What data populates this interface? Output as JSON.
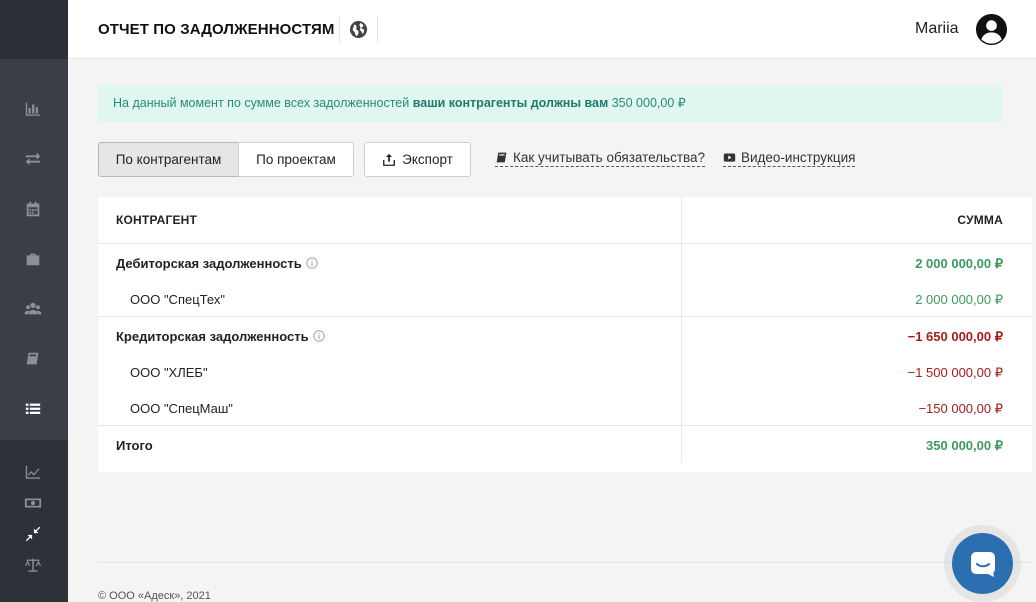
{
  "header": {
    "title": "ОТЧЕТ ПО ЗАДОЛЖЕННОСТЯМ",
    "username": "Mariia"
  },
  "sidebar": {
    "icons": [
      "bar-chart-icon",
      "transfer-icon",
      "calendar-icon",
      "briefcase-icon",
      "users-icon",
      "book-icon",
      "list-icon",
      "line-chart-icon",
      "money-icon",
      "compress-icon",
      "scales-icon"
    ],
    "active": "list-icon"
  },
  "notice": {
    "prefix": "На данный момент по сумме всех задолженностей",
    "emphasis": "ваши контрагенты должны вам",
    "amount": "350 000,00 ₽"
  },
  "toolbar": {
    "by_counterparty": "По контрагентам",
    "by_project": "По проектам",
    "export": "Экспорт",
    "how_to": "Как учитывать обязательства?",
    "video": "Видео-инструкция"
  },
  "table": {
    "col_counterparty": "КОНТРАГЕНТ",
    "col_amount": "СУММА",
    "receivables": {
      "label": "Дебиторская задолженность",
      "amount": "2 000 000,00 ₽",
      "items": [
        {
          "name": "ООО \"СпецТех\"",
          "amount": "2 000 000,00 ₽"
        }
      ]
    },
    "payables": {
      "label": "Кредиторская задолженность",
      "amount": "−1 650 000,00 ₽",
      "items": [
        {
          "name": "ООО \"ХЛЕБ\"",
          "amount": "−1 500 000,00 ₽"
        },
        {
          "name": "ООО \"СпецМаш\"",
          "amount": "−150 000,00 ₽"
        }
      ]
    },
    "total": {
      "label": "Итого",
      "amount": "350 000,00 ₽"
    }
  },
  "footer": {
    "copyright": "© ООО «Адеск», 2021"
  },
  "colors": {
    "positive": "#3c9a5f",
    "negative": "#a61c1c",
    "notice_bg": "#dff6f1",
    "chat": "#2c6fb0"
  }
}
